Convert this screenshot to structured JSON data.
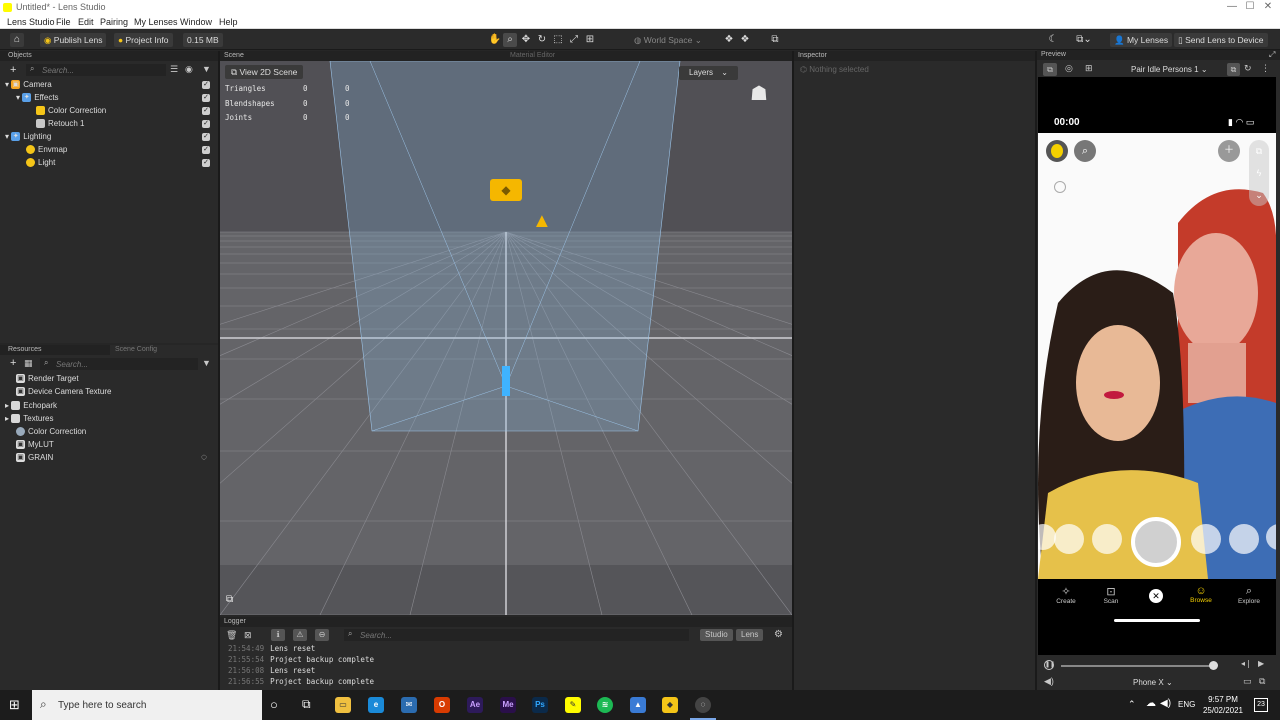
{
  "window": {
    "title": "Untitled* - Lens Studio",
    "controls": [
      "—",
      "☐",
      "✕"
    ]
  },
  "menu": [
    "Lens Studio",
    "File",
    "Edit",
    "Pairing",
    "My Lenses",
    "Window",
    "Help"
  ],
  "toolbar": {
    "publish_label": "Publish Lens",
    "project_info_label": "Project Info",
    "size_label": "0.15 MB",
    "space_label": "World Space",
    "my_lenses_label": "My Lenses",
    "send_label": "Send Lens to Device"
  },
  "objects": {
    "header": "Objects",
    "search_placeholder": "Search...",
    "items": [
      {
        "label": "Camera",
        "depth": 0,
        "icon": "camera-icon"
      },
      {
        "label": "Effects",
        "depth": 1,
        "icon": "effects-icon"
      },
      {
        "label": "Color Correction",
        "depth": 2,
        "icon": "color-correction-icon"
      },
      {
        "label": "Retouch 1",
        "depth": 2,
        "icon": "retouch-icon"
      },
      {
        "label": "Lighting",
        "depth": 0,
        "icon": "lighting-icon"
      },
      {
        "label": "Envmap",
        "depth": 1,
        "icon": "bulb-icon"
      },
      {
        "label": "Light",
        "depth": 1,
        "icon": "bulb-icon"
      }
    ]
  },
  "resources": {
    "header": "Resources",
    "tab2": "Scene Config",
    "search_placeholder": "Search...",
    "items": [
      {
        "label": "Render Target",
        "icon": "render-target-icon"
      },
      {
        "label": "Device Camera Texture",
        "icon": "texture-icon"
      },
      {
        "label": "Echopark",
        "icon": "folder-icon"
      },
      {
        "label": "Textures",
        "icon": "folder-icon"
      },
      {
        "label": "Color Correction",
        "icon": "color-correction-icon"
      },
      {
        "label": "MyLUT",
        "icon": "image-icon"
      },
      {
        "label": "GRAIN",
        "icon": "image-icon"
      }
    ]
  },
  "scene": {
    "header": "Scene",
    "material_editor_tab": "Material Editor",
    "view_2d_label": "View 2D Scene",
    "layers_label": "Layers",
    "stats": [
      {
        "label": "Triangles",
        "a": "0",
        "b": "0"
      },
      {
        "label": "Blendshapes",
        "a": "0",
        "b": "0"
      },
      {
        "label": "Joints",
        "a": "0",
        "b": "0"
      }
    ]
  },
  "inspector": {
    "header": "Inspector",
    "empty_text": "Nothing selected"
  },
  "logger": {
    "header": "Logger",
    "search_placeholder": "Search...",
    "studio_label": "Studio",
    "lens_label": "Lens",
    "lines": [
      {
        "time": "21:54:49",
        "msg": "Lens reset"
      },
      {
        "time": "21:55:54",
        "msg": "Project backup complete"
      },
      {
        "time": "21:56:08",
        "msg": "Lens reset"
      },
      {
        "time": "21:56:55",
        "msg": "Project backup complete"
      }
    ]
  },
  "preview": {
    "header": "Preview",
    "person_select": "Pair Idle Persons 1",
    "time": "00:00",
    "nav": [
      "Create",
      "Scan",
      "Browse",
      "Explore"
    ],
    "device_select": "Phone X"
  },
  "taskbar": {
    "search_placeholder": "Type here to search",
    "lang": "ENG",
    "time": "9:57 PM",
    "date": "25/02/2021",
    "notif_count": "23"
  }
}
